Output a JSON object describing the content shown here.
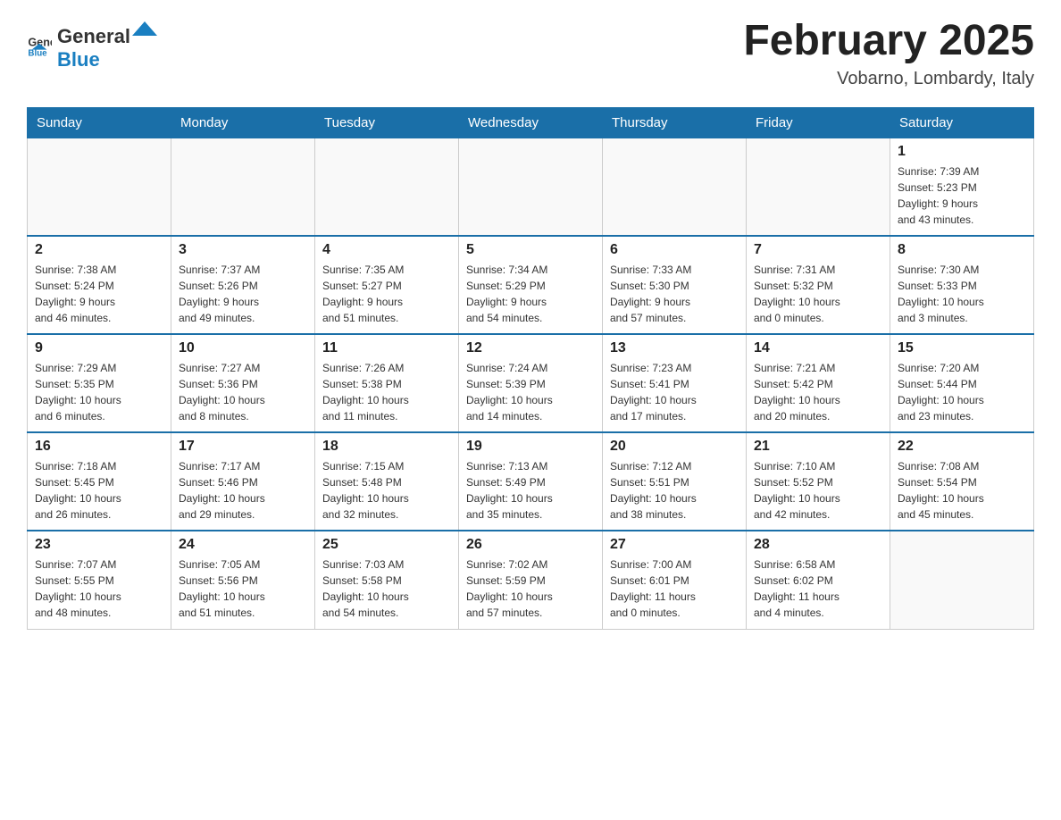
{
  "header": {
    "logo_general": "General",
    "logo_blue": "Blue",
    "title": "February 2025",
    "subtitle": "Vobarno, Lombardy, Italy"
  },
  "columns": [
    "Sunday",
    "Monday",
    "Tuesday",
    "Wednesday",
    "Thursday",
    "Friday",
    "Saturday"
  ],
  "weeks": [
    [
      {
        "day": "",
        "info": ""
      },
      {
        "day": "",
        "info": ""
      },
      {
        "day": "",
        "info": ""
      },
      {
        "day": "",
        "info": ""
      },
      {
        "day": "",
        "info": ""
      },
      {
        "day": "",
        "info": ""
      },
      {
        "day": "1",
        "info": "Sunrise: 7:39 AM\nSunset: 5:23 PM\nDaylight: 9 hours\nand 43 minutes."
      }
    ],
    [
      {
        "day": "2",
        "info": "Sunrise: 7:38 AM\nSunset: 5:24 PM\nDaylight: 9 hours\nand 46 minutes."
      },
      {
        "day": "3",
        "info": "Sunrise: 7:37 AM\nSunset: 5:26 PM\nDaylight: 9 hours\nand 49 minutes."
      },
      {
        "day": "4",
        "info": "Sunrise: 7:35 AM\nSunset: 5:27 PM\nDaylight: 9 hours\nand 51 minutes."
      },
      {
        "day": "5",
        "info": "Sunrise: 7:34 AM\nSunset: 5:29 PM\nDaylight: 9 hours\nand 54 minutes."
      },
      {
        "day": "6",
        "info": "Sunrise: 7:33 AM\nSunset: 5:30 PM\nDaylight: 9 hours\nand 57 minutes."
      },
      {
        "day": "7",
        "info": "Sunrise: 7:31 AM\nSunset: 5:32 PM\nDaylight: 10 hours\nand 0 minutes."
      },
      {
        "day": "8",
        "info": "Sunrise: 7:30 AM\nSunset: 5:33 PM\nDaylight: 10 hours\nand 3 minutes."
      }
    ],
    [
      {
        "day": "9",
        "info": "Sunrise: 7:29 AM\nSunset: 5:35 PM\nDaylight: 10 hours\nand 6 minutes."
      },
      {
        "day": "10",
        "info": "Sunrise: 7:27 AM\nSunset: 5:36 PM\nDaylight: 10 hours\nand 8 minutes."
      },
      {
        "day": "11",
        "info": "Sunrise: 7:26 AM\nSunset: 5:38 PM\nDaylight: 10 hours\nand 11 minutes."
      },
      {
        "day": "12",
        "info": "Sunrise: 7:24 AM\nSunset: 5:39 PM\nDaylight: 10 hours\nand 14 minutes."
      },
      {
        "day": "13",
        "info": "Sunrise: 7:23 AM\nSunset: 5:41 PM\nDaylight: 10 hours\nand 17 minutes."
      },
      {
        "day": "14",
        "info": "Sunrise: 7:21 AM\nSunset: 5:42 PM\nDaylight: 10 hours\nand 20 minutes."
      },
      {
        "day": "15",
        "info": "Sunrise: 7:20 AM\nSunset: 5:44 PM\nDaylight: 10 hours\nand 23 minutes."
      }
    ],
    [
      {
        "day": "16",
        "info": "Sunrise: 7:18 AM\nSunset: 5:45 PM\nDaylight: 10 hours\nand 26 minutes."
      },
      {
        "day": "17",
        "info": "Sunrise: 7:17 AM\nSunset: 5:46 PM\nDaylight: 10 hours\nand 29 minutes."
      },
      {
        "day": "18",
        "info": "Sunrise: 7:15 AM\nSunset: 5:48 PM\nDaylight: 10 hours\nand 32 minutes."
      },
      {
        "day": "19",
        "info": "Sunrise: 7:13 AM\nSunset: 5:49 PM\nDaylight: 10 hours\nand 35 minutes."
      },
      {
        "day": "20",
        "info": "Sunrise: 7:12 AM\nSunset: 5:51 PM\nDaylight: 10 hours\nand 38 minutes."
      },
      {
        "day": "21",
        "info": "Sunrise: 7:10 AM\nSunset: 5:52 PM\nDaylight: 10 hours\nand 42 minutes."
      },
      {
        "day": "22",
        "info": "Sunrise: 7:08 AM\nSunset: 5:54 PM\nDaylight: 10 hours\nand 45 minutes."
      }
    ],
    [
      {
        "day": "23",
        "info": "Sunrise: 7:07 AM\nSunset: 5:55 PM\nDaylight: 10 hours\nand 48 minutes."
      },
      {
        "day": "24",
        "info": "Sunrise: 7:05 AM\nSunset: 5:56 PM\nDaylight: 10 hours\nand 51 minutes."
      },
      {
        "day": "25",
        "info": "Sunrise: 7:03 AM\nSunset: 5:58 PM\nDaylight: 10 hours\nand 54 minutes."
      },
      {
        "day": "26",
        "info": "Sunrise: 7:02 AM\nSunset: 5:59 PM\nDaylight: 10 hours\nand 57 minutes."
      },
      {
        "day": "27",
        "info": "Sunrise: 7:00 AM\nSunset: 6:01 PM\nDaylight: 11 hours\nand 0 minutes."
      },
      {
        "day": "28",
        "info": "Sunrise: 6:58 AM\nSunset: 6:02 PM\nDaylight: 11 hours\nand 4 minutes."
      },
      {
        "day": "",
        "info": ""
      }
    ]
  ]
}
